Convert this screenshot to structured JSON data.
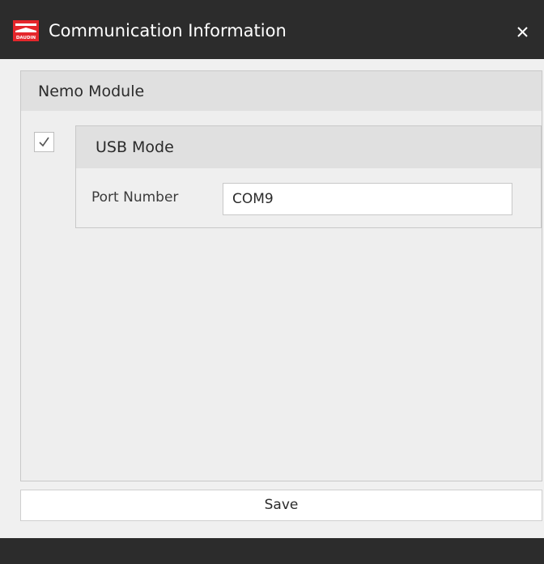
{
  "window": {
    "title": "Communication Information",
    "logo_icon": "daudin-logo",
    "logo_text": "DAUDIN",
    "brand_color": "#e5262b"
  },
  "nemo_module": {
    "header": "Nemo Module",
    "usb_mode": {
      "checked": true,
      "header": "USB Mode",
      "port_label": "Port Number",
      "port_value": "COM9"
    }
  },
  "actions": {
    "save_label": "Save"
  }
}
